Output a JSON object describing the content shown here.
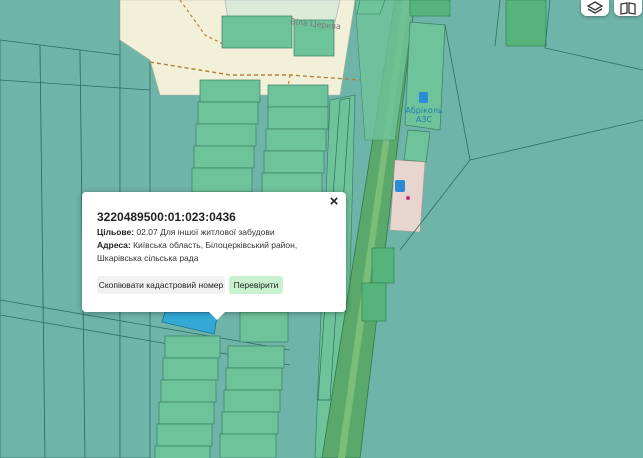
{
  "map": {
    "street_label": "Біла Церква",
    "gas_station_name": "Абріколь",
    "gas_station_type": "АЗС"
  },
  "controls": {
    "layers_icon": "layers-icon",
    "book_icon": "book-map-icon"
  },
  "popup": {
    "cadastral_number": "3220489500:01:023:0436",
    "purpose_label": "Цільове:",
    "purpose_value": "02.07 Для іншої житлової забудови",
    "address_label": "Адреса:",
    "address_value": "Київська область, Білоцерківський район, Шкарівська сільська рада",
    "copy_button": "Скопіювати кадастровий номер",
    "check_button": "Перевірити",
    "close_glyph": "×"
  },
  "colors": {
    "parcel_green": "#6fc39a",
    "parcel_teal": "#6fb4a8",
    "road_green": "#5aa86b",
    "selected_parcel": "#35a9d6",
    "residential_beige": "#f2f0d9"
  }
}
